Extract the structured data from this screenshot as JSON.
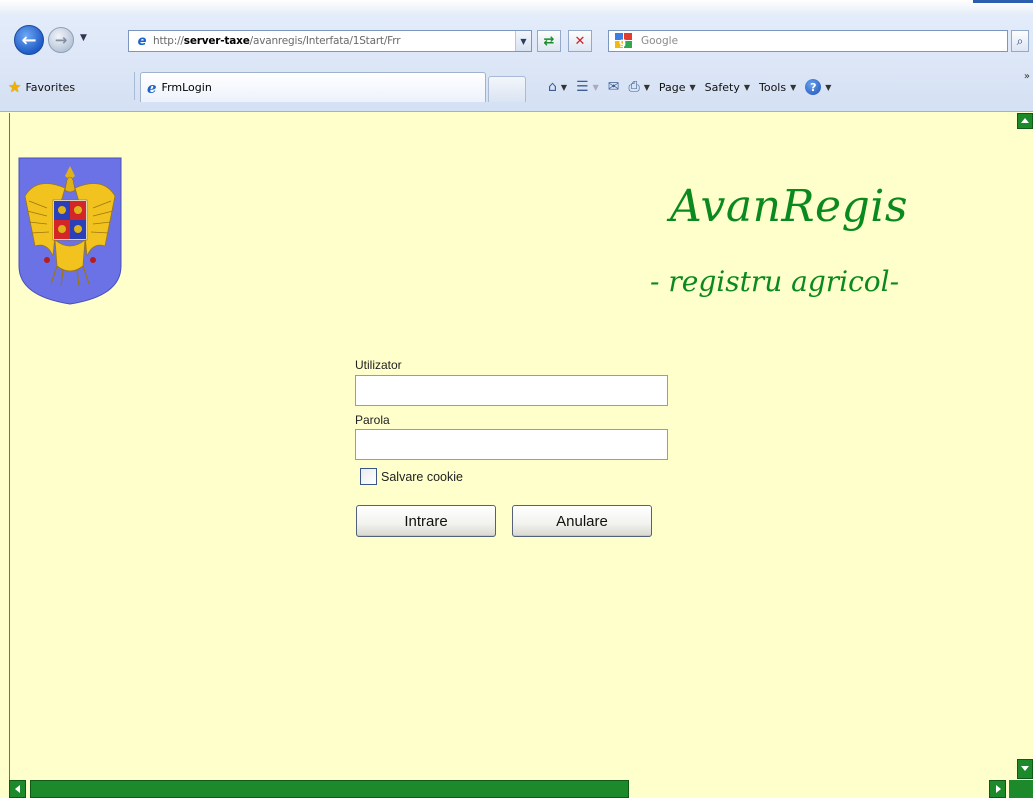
{
  "browser": {
    "url_prefix": "http://",
    "url_host": "server-taxe",
    "url_path": "/avanregis/Interfata/1Start/Frr",
    "search_placeholder": "Google",
    "favorites_label": "Favorites",
    "tab_title": "FrmLogin",
    "command_bar": {
      "page_label": "Page",
      "safety_label": "Safety",
      "tools_label": "Tools"
    },
    "icons": {
      "back": "back-arrow-icon",
      "forward": "forward-arrow-icon",
      "refresh": "refresh-icon",
      "stop": "stop-icon",
      "search": "magnifier-icon",
      "home": "home-icon",
      "feeds": "rss-feed-icon",
      "mail": "read-mail-icon",
      "print": "printer-icon",
      "help": "help-icon"
    }
  },
  "header": {
    "title": "AvanRegis",
    "subtitle": "- registru agricol-"
  },
  "login": {
    "username_label": "Utilizator",
    "username_value": "",
    "password_label": "Parola",
    "password_value": "",
    "remember_label": "Salvare cookie",
    "remember_checked": false,
    "submit_label": "Intrare",
    "cancel_label": "Anulare"
  },
  "colors": {
    "page_background": "#ffffcc",
    "brand_green": "#0a8a1e",
    "scrollbar_green": "#1c8a2a"
  }
}
